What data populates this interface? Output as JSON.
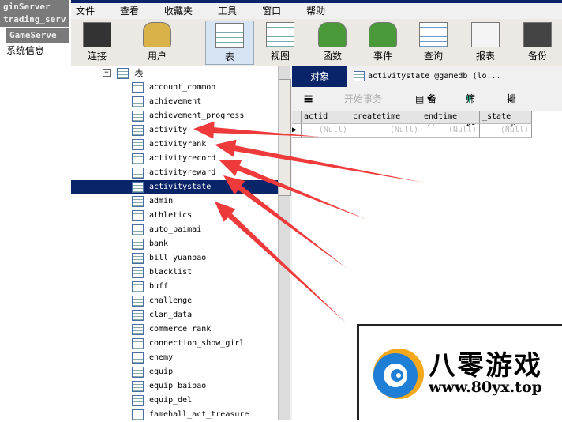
{
  "left": {
    "titles": [
      "ginServer",
      "trading_serv",
      "GameServe"
    ],
    "info": "系统信息"
  },
  "menu": [
    "文件",
    "查看",
    "收藏夹",
    "工具",
    "窗口",
    "帮助"
  ],
  "toolbar": [
    {
      "label": "连接",
      "icon": "connect-icon"
    },
    {
      "label": "用户",
      "icon": "user-icon"
    },
    {
      "label": "表",
      "icon": "table-icon",
      "selected": true
    },
    {
      "label": "视图",
      "icon": "view-icon"
    },
    {
      "label": "函数",
      "icon": "function-icon"
    },
    {
      "label": "事件",
      "icon": "event-icon"
    },
    {
      "label": "查询",
      "icon": "query-icon"
    },
    {
      "label": "报表",
      "icon": "report-icon"
    },
    {
      "label": "备份",
      "icon": "backup-icon"
    }
  ],
  "tree": {
    "root": "表",
    "selected": "activitystate",
    "items": [
      "account_common",
      "achievement",
      "achievement_progress",
      "activity",
      "activityrank",
      "activityrecord",
      "activityreward",
      "activitystate",
      "admin",
      "athletics",
      "auto_paimai",
      "bank",
      "bill_yuanbao",
      "blacklist",
      "buff",
      "challenge",
      "clan_data",
      "commerce_rank",
      "connection_show_girl",
      "enemy",
      "equip",
      "equip_baibao",
      "equip_del",
      "famehall_act_treasure"
    ]
  },
  "tabs": {
    "objects": "对象",
    "table": "activitystate @gamedb (lo..."
  },
  "data_toolbar": {
    "begin_tx": "开始事务",
    "note": "备注",
    "filter": "筛选",
    "sort": "排序"
  },
  "grid": {
    "columns": [
      "actid",
      "createtime",
      "endtime",
      "_state"
    ],
    "rows": [
      [
        "(Null)",
        "(Null)",
        "(Null)",
        "(Null)"
      ]
    ]
  },
  "logo": {
    "name": "八零游戏",
    "url": "www.80yx.top"
  },
  "colors": {
    "selection": "#0a246a",
    "arrow": "#ee3a3a"
  }
}
